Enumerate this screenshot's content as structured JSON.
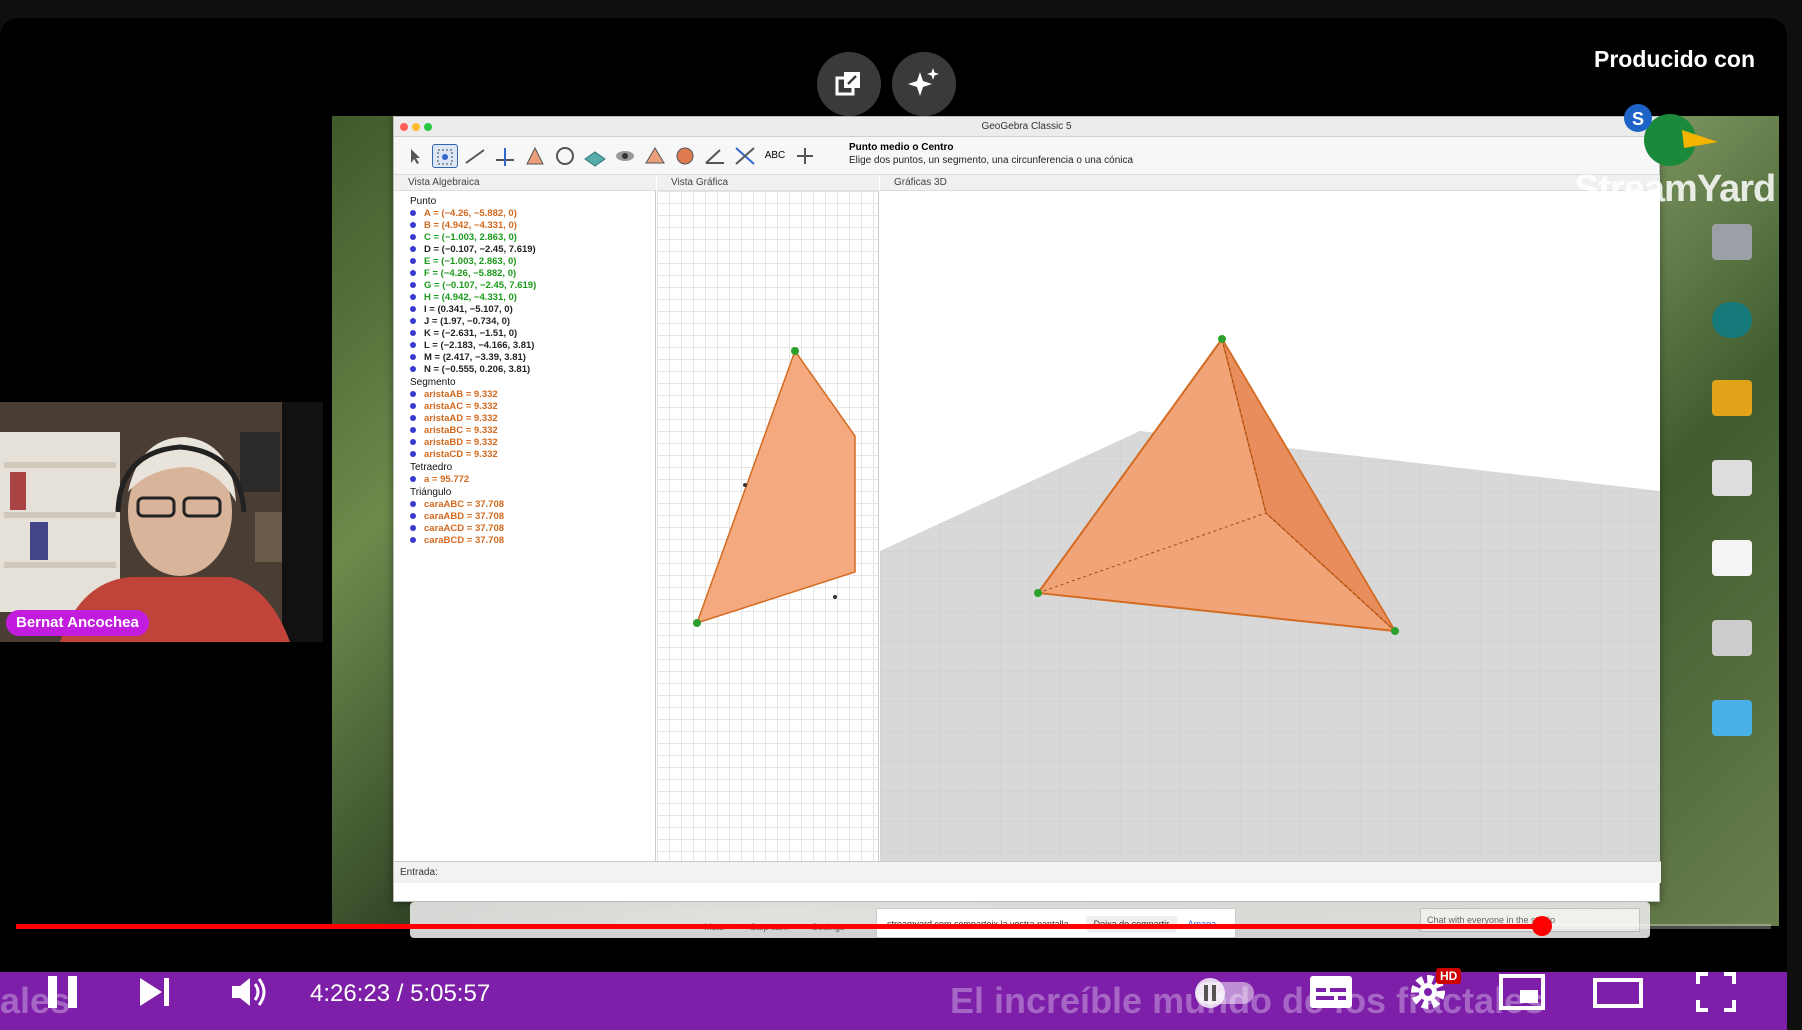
{
  "overlay": {
    "produced_by": "Producido con",
    "streamyard_logo": "StreamYard",
    "buttons": [
      {
        "icon": "external-link-icon",
        "label": ""
      },
      {
        "icon": "sparkles-icon",
        "label": ""
      }
    ]
  },
  "geogebra": {
    "window_title": "GeoGebra Classic 5",
    "tool_title": "Punto medio o Centro",
    "tool_description": "Elige dos puntos, un segmento, una circunferencia o una cónica",
    "panels": {
      "algebra": "Vista Algebraica",
      "graphics": "Vista Gráfica",
      "graphics3d": "Gráficas 3D"
    },
    "input_label": "Entrada:",
    "algebra_groups": [
      {
        "title": "Punto",
        "items": [
          {
            "text": "A = (−4.26, −5.882, 0)",
            "color": "#d2691e"
          },
          {
            "text": "B = (4.942, −4.331, 0)",
            "color": "#d2691e"
          },
          {
            "text": "C = (−1.003, 2.863, 0)",
            "color": "#1a9a1a"
          },
          {
            "text": "D = (−0.107, −2.45, 7.619)",
            "color": "#222222"
          },
          {
            "text": "E = (−1.003, 2.863, 0)",
            "color": "#1a9a1a"
          },
          {
            "text": "F = (−4.26, −5.882, 0)",
            "color": "#1a9a1a"
          },
          {
            "text": "G = (−0.107, −2.45, 7.619)",
            "color": "#1a9a1a"
          },
          {
            "text": "H = (4.942, −4.331, 0)",
            "color": "#1a9a1a"
          },
          {
            "text": "I = (0.341, −5.107, 0)",
            "color": "#222222"
          },
          {
            "text": "J = (1.97, −0.734, 0)",
            "color": "#222222"
          },
          {
            "text": "K = (−2.631, −1.51, 0)",
            "color": "#222222"
          },
          {
            "text": "L = (−2.183, −4.166, 3.81)",
            "color": "#222222"
          },
          {
            "text": "M = (2.417, −3.39, 3.81)",
            "color": "#222222"
          },
          {
            "text": "N = (−0.555, 0.206, 3.81)",
            "color": "#222222"
          }
        ]
      },
      {
        "title": "Segmento",
        "items": [
          {
            "text": "aristaAB = 9.332",
            "color": "#d2691e"
          },
          {
            "text": "aristaAC = 9.332",
            "color": "#d2691e"
          },
          {
            "text": "aristaAD = 9.332",
            "color": "#d2691e"
          },
          {
            "text": "aristaBC = 9.332",
            "color": "#d2691e"
          },
          {
            "text": "aristaBD = 9.332",
            "color": "#d2691e"
          },
          {
            "text": "aristaCD = 9.332",
            "color": "#d2691e"
          }
        ]
      },
      {
        "title": "Tetraedro",
        "items": [
          {
            "text": "a = 95.772",
            "color": "#d2691e"
          }
        ]
      },
      {
        "title": "Triángulo",
        "items": [
          {
            "text": "caraABC = 37.708",
            "color": "#d2691e"
          },
          {
            "text": "caraABD = 37.708",
            "color": "#d2691e"
          },
          {
            "text": "caraACD = 37.708",
            "color": "#d2691e"
          },
          {
            "text": "caraBCD = 37.708",
            "color": "#d2691e"
          }
        ]
      }
    ]
  },
  "streamyard_bar": {
    "items": [
      "Mute",
      "Stop cam",
      "Settings"
    ],
    "share_note": "streamyard.com comparteix la vostra pantalla.",
    "stop_share": "Deixa de compartir",
    "hide": "Amaga",
    "chat_placeholder": "Chat with everyone in the studio"
  },
  "camera": {
    "name": "Bernat Ancochea"
  },
  "player": {
    "time_current": "4:26:23",
    "time_separator": " / ",
    "time_total": "5:05:57",
    "progress_fraction": 0.8697,
    "caption_text": "El increíble mundo de los fractales",
    "caption_left": "ales",
    "hd_badge": "HD",
    "accent_color": "#ff0000",
    "bar_color": "#7d1fa8"
  }
}
